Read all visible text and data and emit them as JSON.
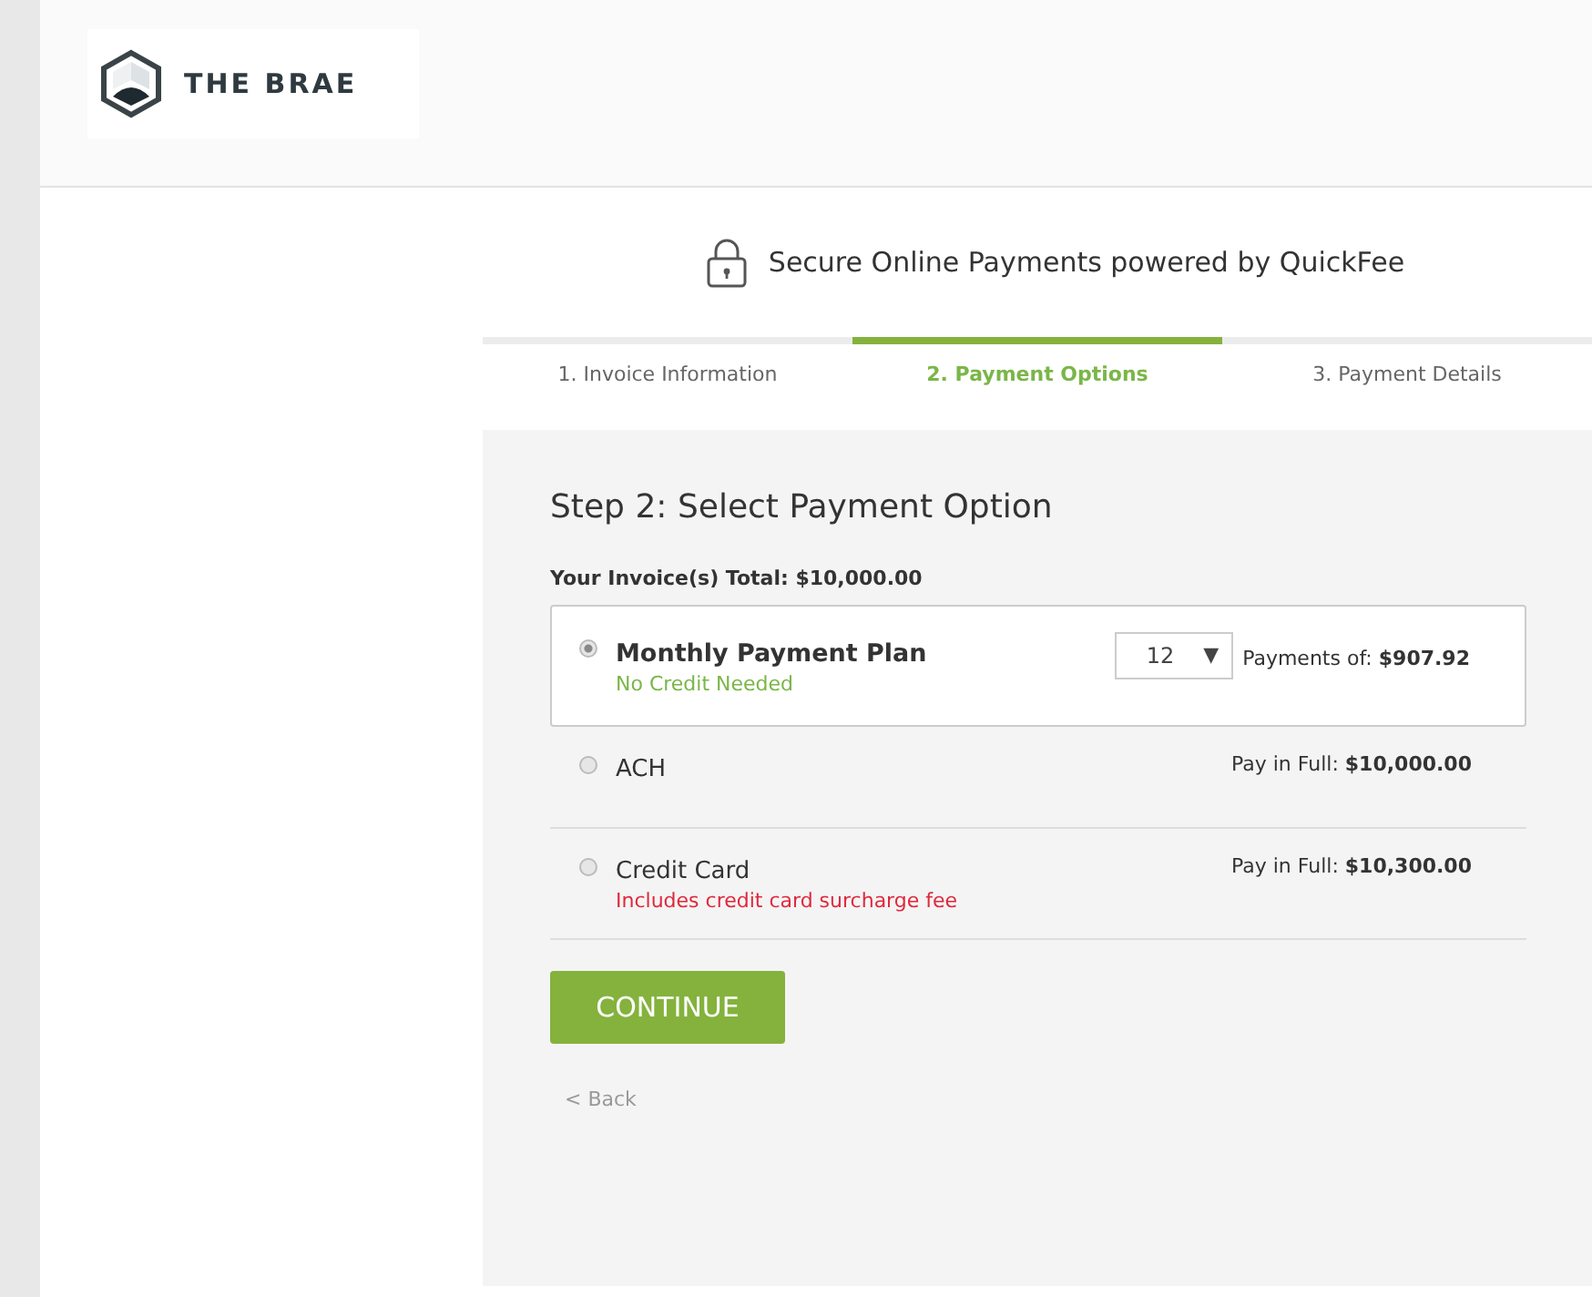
{
  "brand": {
    "name": "THE BRAE"
  },
  "header": {
    "title": "Secure Online Payments powered by QuickFee"
  },
  "steps": [
    {
      "label": "1. Invoice Information",
      "selected": false
    },
    {
      "label": "2. Payment Options",
      "selected": true
    },
    {
      "label": "3. Payment Details",
      "selected": false
    }
  ],
  "panel": {
    "heading": "Step 2: Select Payment Option",
    "total": "Your Invoice(s) Total: $10,000.00",
    "options": [
      {
        "kind": "plan",
        "label": "Monthly Payment Plan",
        "note": {
          "text": "No Credit Needed",
          "color": "#7ab648"
        },
        "select": {
          "value": "12",
          "arrow": "▼"
        },
        "amount": "Payments of: **$907.92**",
        "selected": true
      },
      {
        "kind": "full",
        "label": "ACH",
        "amount": "Pay in Full: **$10,000.00**",
        "selected": false
      },
      {
        "kind": "full",
        "label": "Credit Card",
        "note": {
          "text": "Includes credit card surcharge fee",
          "color": "#e0283c"
        },
        "amount": "Pay in Full: **$10,300.00**",
        "selected": false
      }
    ],
    "continue": "CONTINUE",
    "back": "< Back"
  }
}
